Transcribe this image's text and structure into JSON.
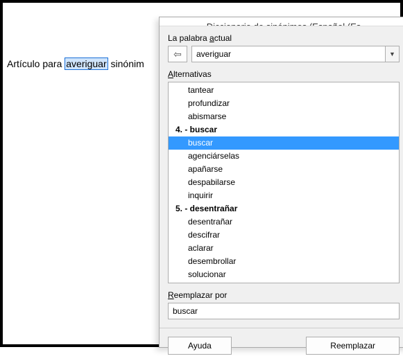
{
  "document": {
    "before": "Artículo para ",
    "marked": "averiguar",
    "after": " sinónim"
  },
  "dialog": {
    "title": "Diccionario de sinónimos (Español (Es",
    "currentWordLabel_pre": "La palabra ",
    "currentWordLabel_u": "a",
    "currentWordLabel_post": "ctual",
    "currentWord": "averiguar",
    "alternativesLabel_u": "A",
    "alternativesLabel_post": "lternativas",
    "alternatives": [
      {
        "text": "tantear",
        "group": false,
        "selected": false
      },
      {
        "text": "profundizar",
        "group": false,
        "selected": false
      },
      {
        "text": "abismarse",
        "group": false,
        "selected": false
      },
      {
        "text": "4. - buscar",
        "group": true,
        "selected": false
      },
      {
        "text": "buscar",
        "group": false,
        "selected": true
      },
      {
        "text": "agenciárselas",
        "group": false,
        "selected": false
      },
      {
        "text": "apañarse",
        "group": false,
        "selected": false
      },
      {
        "text": "despabilarse",
        "group": false,
        "selected": false
      },
      {
        "text": "inquirir",
        "group": false,
        "selected": false
      },
      {
        "text": "5. - desentrañar",
        "group": true,
        "selected": false
      },
      {
        "text": "desentrañar",
        "group": false,
        "selected": false
      },
      {
        "text": "descifrar",
        "group": false,
        "selected": false
      },
      {
        "text": "aclarar",
        "group": false,
        "selected": false
      },
      {
        "text": "desembrollar",
        "group": false,
        "selected": false
      },
      {
        "text": "solucionar",
        "group": false,
        "selected": false
      }
    ],
    "replaceLabel_u": "R",
    "replaceLabel_post": "eemplazar por",
    "replaceValue": "buscar",
    "helpButton": "Ayuda",
    "replaceButton": "Reemplazar"
  },
  "icons": {
    "backArrow": "⇦",
    "dropdown": "▼"
  }
}
